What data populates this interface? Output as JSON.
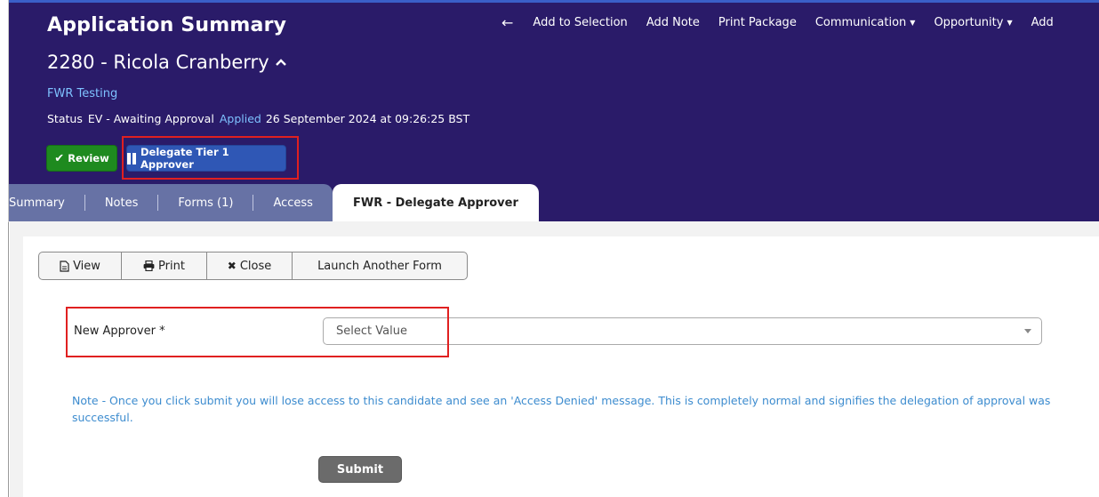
{
  "header": {
    "app_title": "Application Summary",
    "actions": {
      "back_arrow": "←",
      "add_to_selection": "Add to Selection",
      "add_note": "Add Note",
      "print_package": "Print Package",
      "communication": "Communication",
      "opportunity": "Opportunity",
      "add_truncated": "Add"
    },
    "candidate_title": "2280 - Ricola Cranberry",
    "org_link": "FWR Testing",
    "status_label": "Status",
    "status_value": "EV - Awaiting Approval",
    "applied_label": "Applied",
    "applied_value": "26 September 2024 at 09:26:25 BST",
    "buttons": {
      "review": "Review",
      "delegate": "Delegate Tier 1 Approver"
    }
  },
  "tabs": [
    {
      "label": "Summary"
    },
    {
      "label": "Notes"
    },
    {
      "label": "Forms (1)"
    },
    {
      "label": "Access"
    },
    {
      "label": "FWR - Delegate Approver",
      "active": true
    }
  ],
  "toolbar": {
    "view": "View",
    "print": "Print",
    "close": "Close",
    "launch": "Launch Another Form"
  },
  "form": {
    "new_approver_label": "New Approver *",
    "select_placeholder": "Select Value",
    "note": "Note - Once you click submit you will lose access to this candidate and see an 'Access Denied' message. This is completely normal and signifies the delegation of approval was successful.",
    "submit": "Submit"
  },
  "colors": {
    "header_bg": "#2a1b69",
    "link_blue": "#7ec2ff",
    "review_green": "#1e8a1f",
    "delegate_blue": "#2f57b5",
    "tab_grey": "#6772a5",
    "highlight_red": "#e02020",
    "note_blue": "#3d8ccf"
  }
}
